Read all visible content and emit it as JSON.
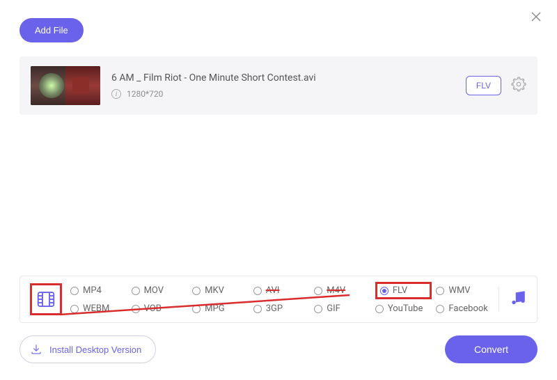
{
  "buttons": {
    "add_file": "Add File",
    "install": "Install Desktop Version",
    "convert": "Convert"
  },
  "file": {
    "title": "6 AM _ Film Riot - One Minute Short Contest.avi",
    "resolution": "1280*720",
    "output_format": "FLV"
  },
  "formats": {
    "row1": [
      "MP4",
      "MOV",
      "MKV",
      "AVI",
      "M4V",
      "FLV",
      "WMV"
    ],
    "row2": [
      "WEBM",
      "VOB",
      "MPG",
      "3GP",
      "GIF",
      "YouTube",
      "Facebook"
    ],
    "selected": "FLV",
    "struck": [
      "AVI",
      "M4V"
    ]
  },
  "icons": {
    "close": "close-icon",
    "info": "info-icon",
    "gear": "gear-icon",
    "video": "video-icon",
    "music": "music-icon",
    "download": "download-icon"
  },
  "colors": {
    "accent": "#6a62ea",
    "highlight": "#d92c2c",
    "panel": "#f5f5f7"
  }
}
